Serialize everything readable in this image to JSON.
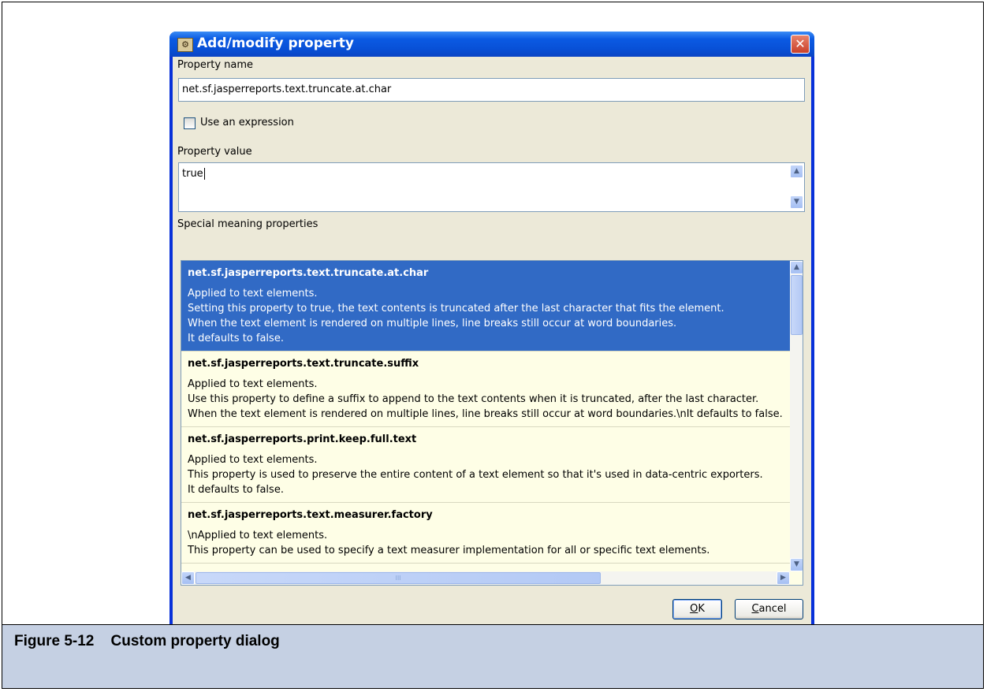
{
  "dialog": {
    "title": "Add/modify property",
    "close_glyph": "✕",
    "icon": "app-icon"
  },
  "property_name": {
    "label": "Property name",
    "value": "net.sf.jasperreports.text.truncate.at.char"
  },
  "use_expression": {
    "label": "Use an expression",
    "checked": false
  },
  "property_value": {
    "label": "Property value",
    "value": "true"
  },
  "special": {
    "label": "Special meaning properties",
    "items": [
      {
        "title": "net.sf.jasperreports.text.truncate.at.char",
        "lines": [
          "Applied to text elements.",
          "Setting this property to true, the text contents is truncated after the last character that fits the element.",
          "When the text element is rendered on multiple lines, line breaks still occur at word boundaries.",
          "It defaults to false."
        ]
      },
      {
        "title": "net.sf.jasperreports.text.truncate.suffix",
        "lines": [
          "Applied to text elements.",
          "Use this property to define a suffix to append to the text contents when it is truncated, after the last character.",
          "When the text element is rendered on multiple lines, line breaks still occur at word boundaries.\\nIt defaults to false."
        ]
      },
      {
        "title": "net.sf.jasperreports.print.keep.full.text",
        "lines": [
          "Applied to text elements.",
          "This property is used to preserve the entire content of a text element so that it's used in data-centric exporters.",
          "It defaults to false."
        ]
      },
      {
        "title": "net.sf.jasperreports.text.measurer.factory",
        "lines": [
          "\\nApplied to text elements.",
          "This property can be used to specify a text measurer implementation for all or specific text elements."
        ]
      }
    ]
  },
  "buttons": {
    "ok_mnemonic": "O",
    "ok_rest": "K",
    "cancel_mnemonic": "C",
    "cancel_rest": "ancel"
  },
  "scroll_glyphs": {
    "up": "▲",
    "down": "▼",
    "left": "◀",
    "right": "▶",
    "grip": "III"
  },
  "figure": {
    "label": "Figure 5-12",
    "title": "Custom property dialog"
  }
}
